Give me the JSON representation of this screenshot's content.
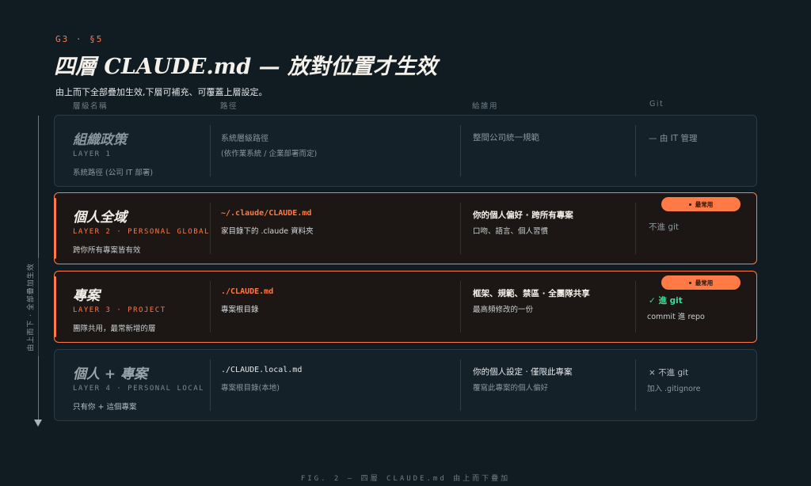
{
  "header": {
    "eyebrow": "G3 · §5",
    "title": "四層 CLAUDE.md — 放對位置才生效",
    "subtitle": "由上而下全部疊加生效,下層可補充、可覆蓋上層設定。"
  },
  "columns": {
    "name": "層級名稱",
    "path": "路徑",
    "for": "給誰用",
    "git": "Git"
  },
  "axis": {
    "label": "由上而下 · 全部疊加生效"
  },
  "badge_label": "最常用",
  "layers": [
    {
      "name": "組織政策",
      "tag": "LAYER 1",
      "note": "系統路徑 (公司 IT 部署)",
      "path": "系統層級路徑",
      "path_sub": "(依作業系統 / 企業部署而定)",
      "for": "整間公司統一規範",
      "for_sub": "",
      "git": "— 由 IT 管理",
      "git_sub": "",
      "most_used": false
    },
    {
      "name": "個人全域",
      "tag": "LAYER 2 · PERSONAL GLOBAL",
      "note": "跨你所有專案皆有效",
      "path": "~/.claude/CLAUDE.md",
      "path_sub": "家目錄下的 .claude 資料夾",
      "for": "你的個人偏好 · 跨所有專案",
      "for_sub": "口吻、語言、個人習慣",
      "git": "不進 git",
      "git_sub": "",
      "most_used": true
    },
    {
      "name": "專案",
      "tag": "LAYER 3 · PROJECT",
      "note": "團隊共用，最常新增的層",
      "path": "./CLAUDE.md",
      "path_sub": "專案根目錄",
      "for": "框架、規範、禁區 · 全團隊共享",
      "for_sub": "最高頻修改的一份",
      "git": "✓  進 git",
      "git_sub": "commit 進 repo",
      "most_used": true
    },
    {
      "name": "個人 + 專案",
      "tag": "LAYER 4 · PERSONAL LOCAL",
      "note": "只有你 + 這個專案",
      "path": "./CLAUDE.local.md",
      "path_sub": "專案根目錄(本地)",
      "for": "你的個人設定 · 僅限此專案",
      "for_sub": "覆寫此專案的個人偏好",
      "git": "×   不進 git",
      "git_sub": "加入 .gitignore",
      "most_used": false
    }
  ],
  "caption": "FIG. 2 — 四層 CLAUDE.md 由上而下疊加",
  "colors": {
    "accent": "#ff7a45",
    "git_ok": "#3ddc97",
    "background": "#101b22"
  }
}
